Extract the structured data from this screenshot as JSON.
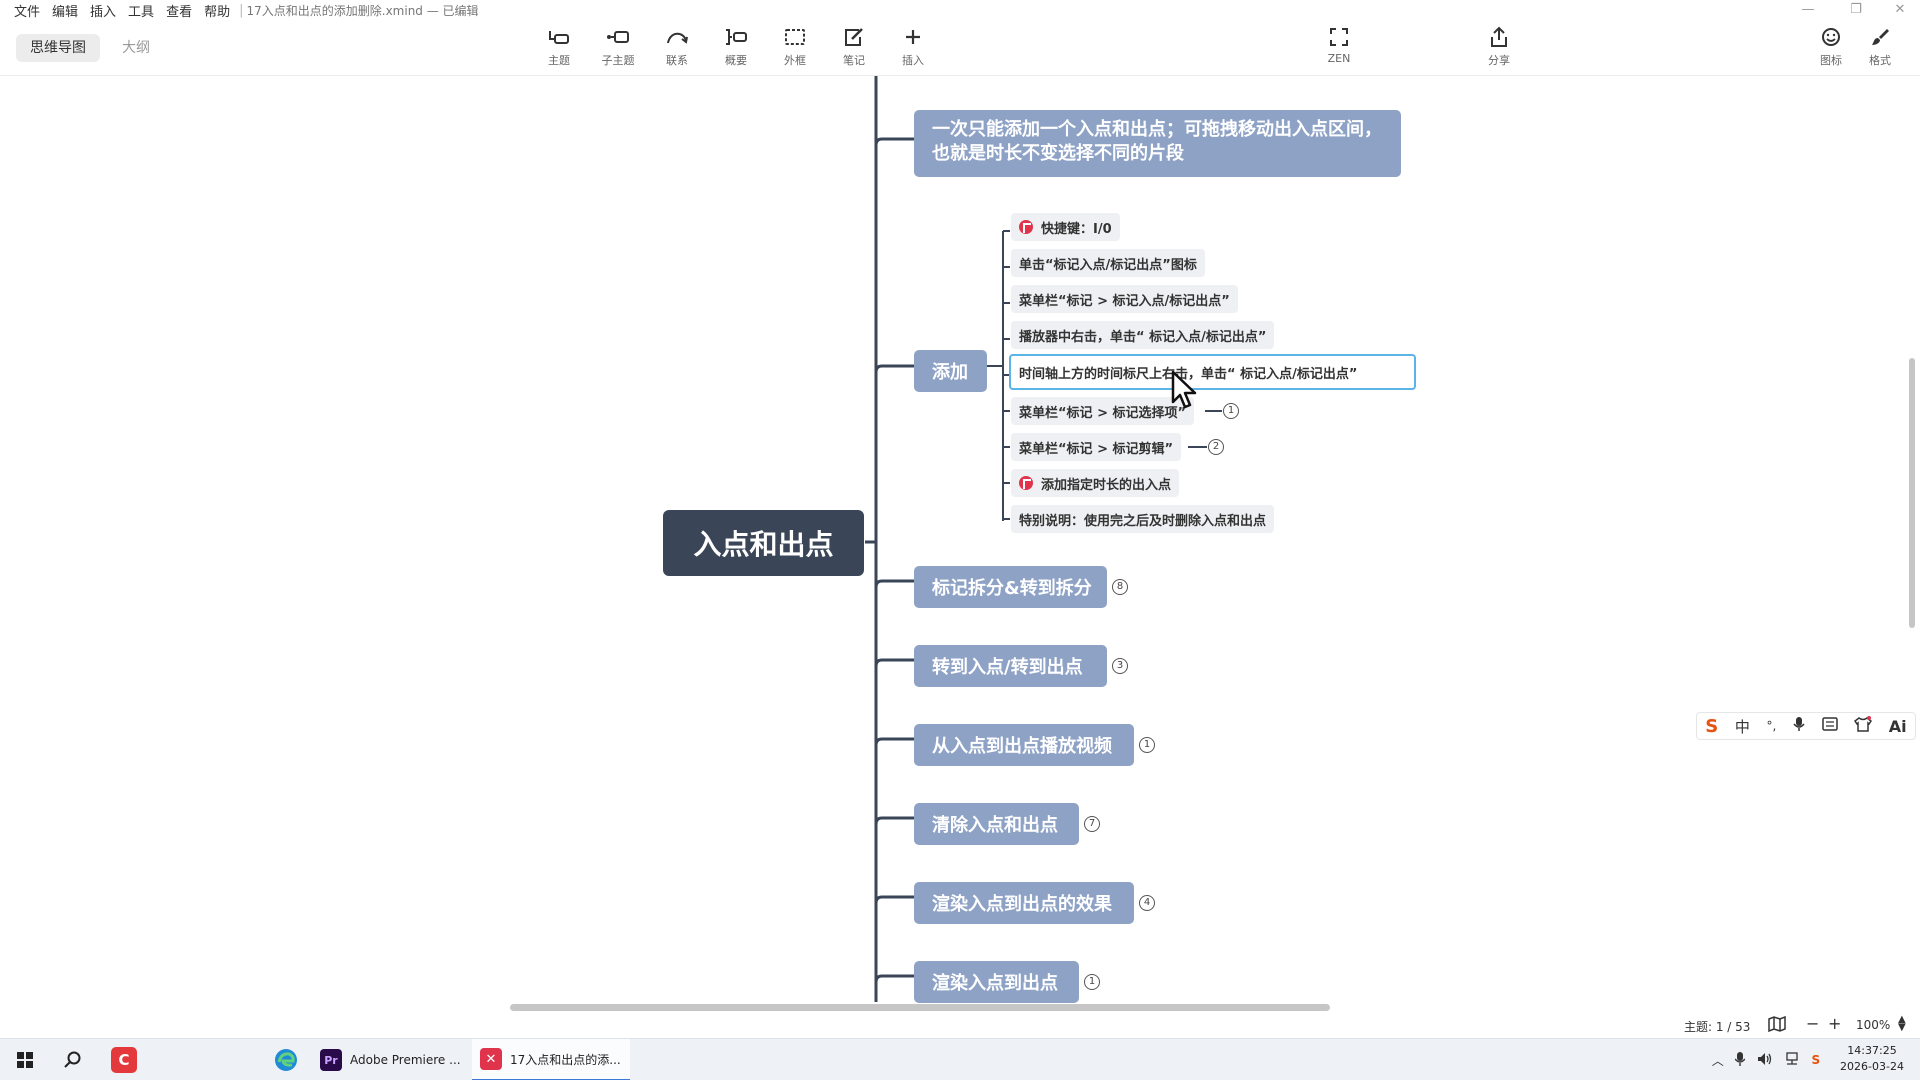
{
  "window": {
    "menu": [
      "文件",
      "编辑",
      "插入",
      "工具",
      "查看",
      "帮助"
    ],
    "doc_title": "17入点和出点的添加删除.xmind — 已编辑"
  },
  "toolbar": {
    "view_tabs": [
      "思维导图",
      "大纲"
    ],
    "tools": [
      {
        "label": "主题",
        "icon": "topic-icon"
      },
      {
        "label": "子主题",
        "icon": "subtopic-icon"
      },
      {
        "label": "联系",
        "icon": "relationship-icon"
      },
      {
        "label": "概要",
        "icon": "summary-icon"
      },
      {
        "label": "外框",
        "icon": "boundary-icon"
      },
      {
        "label": "笔记",
        "icon": "note-icon"
      },
      {
        "label": "插入",
        "icon": "insert-icon"
      }
    ],
    "zen_label": "ZEN",
    "share_label": "分享",
    "icon_panel_label": "图标",
    "format_label": "格式"
  },
  "mindmap": {
    "central": "入点和出点",
    "top_note": "一次只能添加一个入点和出点；可拖拽移动出入点区间，也就是时长不变选择不同的片段",
    "add_topic": "添加",
    "add_children": [
      {
        "text": "快捷键：I/0",
        "flag": true
      },
      {
        "text": "单击“标记入点/标记出点”图标",
        "flag": false
      },
      {
        "text": "菜单栏“标记 > 标记入点/标记出点”",
        "flag": false
      },
      {
        "text": "播放器中右击，单击“ 标记入点/标记出点”",
        "flag": false
      },
      {
        "text": "时间轴上方的时间标尺上右击，单击“ 标记入点/标记出点”",
        "flag": false,
        "selected": true
      },
      {
        "text": "菜单栏“标记 > 标记选择项”",
        "flag": false,
        "badge": "1"
      },
      {
        "text": "菜单栏“标记 > 标记剪辑”",
        "flag": false,
        "badge": "2"
      },
      {
        "text": "添加指定时长的出入点",
        "flag": true
      },
      {
        "text": "特别说明：使用完之后及时删除入点和出点",
        "flag": false
      }
    ],
    "topics": [
      {
        "text": "标记拆分&转到拆分",
        "badge": "8"
      },
      {
        "text": "转到入点/转到出点",
        "badge": "3"
      },
      {
        "text": "从入点到出点播放视频",
        "badge": "1"
      },
      {
        "text": "清除入点和出点",
        "badge": "7"
      },
      {
        "text": "渲染入点到出点的效果",
        "badge": "4"
      },
      {
        "text": "渲染入点到出点",
        "badge": "1"
      }
    ]
  },
  "statusbar": {
    "topic_count": "主题: 1 / 53",
    "zoom": "100%"
  },
  "ime": [
    "中",
    "°,",
    "🎙",
    "⌨",
    "👕",
    "Ai"
  ],
  "taskbar": {
    "apps": [
      {
        "label": "Adobe Premiere ...",
        "icon": "premiere-icon"
      },
      {
        "label": "17入点和出点的添...",
        "icon": "xmind-icon"
      }
    ],
    "time": "14:37:25",
    "date": "2026-03-24"
  },
  "colors": {
    "central_bg": "#3a4657",
    "topic_bg": "#8ea2c6",
    "subtopic_bg": "#eef0f3",
    "selection": "#5ab4e6",
    "flag": "#e0334c",
    "line": "#3a4657"
  }
}
